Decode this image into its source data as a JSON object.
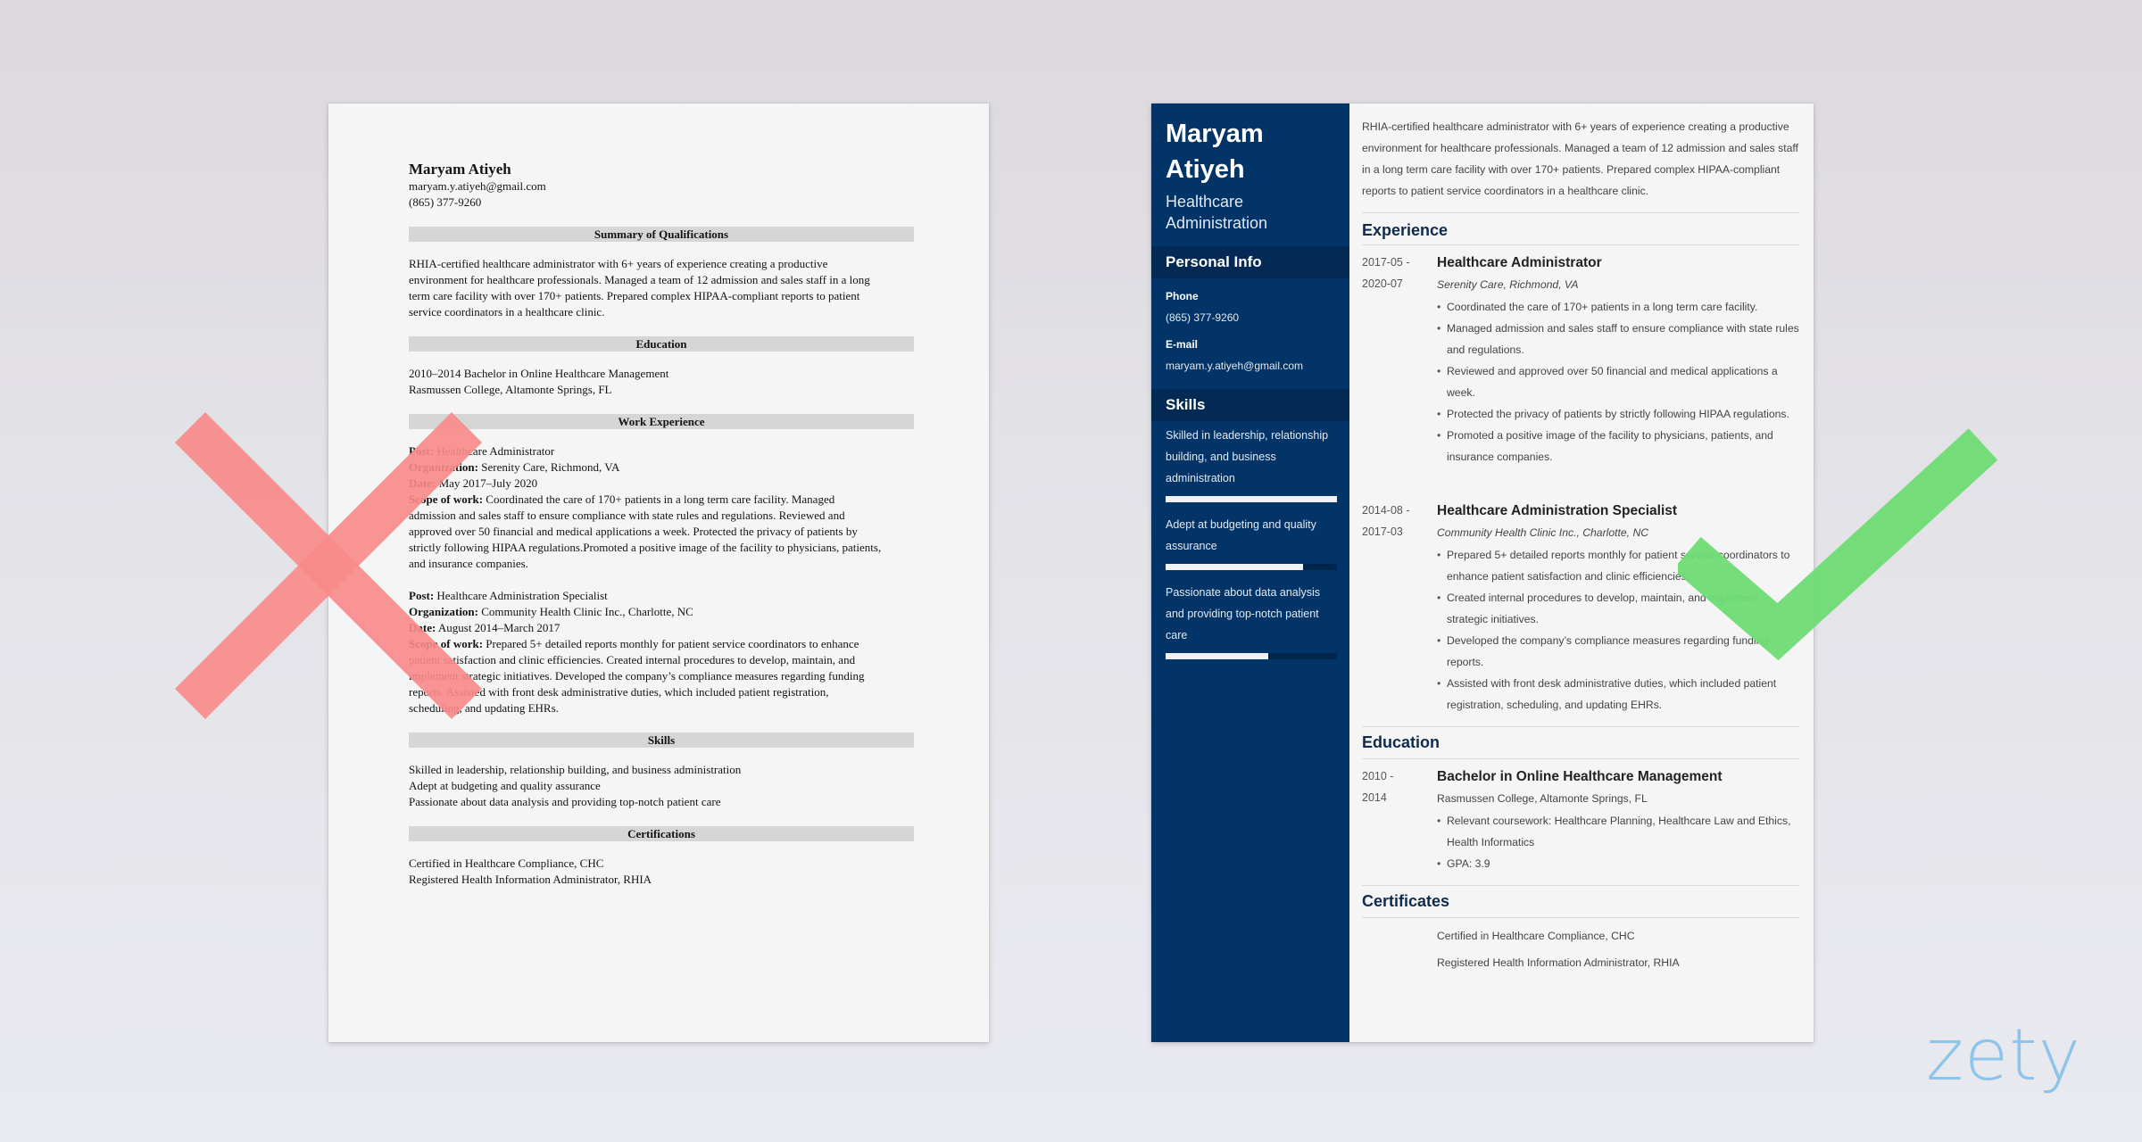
{
  "bad_resume": {
    "name": "Maryam Atiyeh",
    "email": "maryam.y.atiyeh@gmail.com",
    "phone": "(865) 377-9260",
    "sections": {
      "summary": "Summary of Qualifications",
      "education": "Education",
      "work": "Work Experience",
      "skills": "Skills",
      "certifications": "Certifications"
    },
    "summary_lines": [
      "RHIA-certified healthcare administrator with 6+ years of experience creating a productive",
      "environment for healthcare professionals. Managed a team of 12 admission and sales staff in a long",
      "term care facility with over 170+ patients. Prepared complex HIPAA-compliant reports to patient",
      "service coordinators in a healthcare clinic."
    ],
    "education_lines": [
      "2010–2014 Bachelor in Online Healthcare Management",
      "Rasmussen College, Altamonte Springs, FL"
    ],
    "labels": {
      "post": "Post:",
      "organization": "Organization:",
      "date": "Date:",
      "scope": "Scope of work:"
    },
    "jobs": [
      {
        "post": "Healthcare Administrator",
        "organization": "Serenity Care, Richmond, VA",
        "date": "May 2017–July 2020",
        "scope_lines": [
          "Coordinated the care of 170+ patients in a long term care facility. Managed",
          "admission and sales staff to ensure compliance with state rules and regulations.  Reviewed and",
          "approved over 50 financial and medical applications a week. Protected the privacy of patients by",
          "strictly following HIPAA regulations.Promoted a positive image of the facility to physicians, patients,",
          "and insurance companies."
        ]
      },
      {
        "post": "Healthcare Administration Specialist",
        "organization": "Community Health Clinic Inc., Charlotte, NC",
        "date": "August 2014–March 2017",
        "scope_lines": [
          "Prepared 5+ detailed reports monthly for patient service coordinators to enhance",
          "patient satisfaction and clinic efficiencies. Created internal procedures to develop, maintain, and",
          "implement strategic initiatives. Developed the company’s compliance measures regarding funding",
          "reports. Assisted with front desk administrative duties, which included patient registration,",
          "scheduling, and updating EHRs."
        ]
      }
    ],
    "skills": [
      "Skilled in leadership, relationship building, and business administration",
      "Adept at budgeting and quality assurance",
      "Passionate about data analysis and providing top-notch patient care"
    ],
    "certifications": [
      "Certified in Healthcare Compliance, CHC",
      "Registered Health Information Administrator, RHIA"
    ]
  },
  "good_resume": {
    "colors": {
      "sidebar": "#023467",
      "sidebar_header": "#022a55",
      "heading": "#0f2c4f"
    },
    "sidebar": {
      "first_name": "Maryam",
      "last_name": "Atiyeh",
      "title_line1": "Healthcare",
      "title_line2": "Administration",
      "personal_info_heading": "Personal Info",
      "phone_label": "Phone",
      "phone": "(865) 377-9260",
      "email_label": "E-mail",
      "email": "maryam.y.atiyeh@gmail.com",
      "skills_heading": "Skills",
      "skills": [
        {
          "text": "Skilled in leadership, relationship building, and business administration",
          "level": 1.0
        },
        {
          "text": "Adept at budgeting and quality assurance",
          "level": 0.8
        },
        {
          "text": "Passionate about data analysis and providing top-notch patient care",
          "level": 0.6
        }
      ]
    },
    "summary": "RHIA-certified healthcare administrator with 6+ years of experience creating a productive environment for healthcare professionals. Managed a team of 12 admission and sales staff in a long term care facility with over 170+ patients. Prepared complex HIPAA-compliant reports to patient service coordinators in a healthcare clinic.",
    "experience_heading": "Experience",
    "experience": [
      {
        "date_start": "2017-05 -",
        "date_end": "2020-07",
        "title": "Healthcare Administrator",
        "company": "Serenity Care, Richmond, VA",
        "bullets": [
          "Coordinated the care of 170+ patients in a long term care facility.",
          "Managed admission and sales staff to ensure compliance with state rules and regulations.",
          "Reviewed and approved over 50 financial and medical applications a week.",
          "Protected the privacy of patients by strictly following HIPAA regulations.",
          "Promoted a positive image of the facility to physicians, patients, and insurance companies."
        ]
      },
      {
        "date_start": "2014-08 -",
        "date_end": "2017-03",
        "title": "Healthcare Administration Specialist",
        "company": "Community Health Clinic Inc., Charlotte, NC",
        "bullets": [
          "Prepared 5+ detailed reports monthly for patient service coordinators to enhance patient satisfaction and clinic efficiencies.",
          "Created internal procedures to develop, maintain, and implement strategic initiatives.",
          "Developed the company’s compliance measures regarding funding reports.",
          "Assisted with front desk administrative duties, which included patient registration, scheduling, and updating EHRs."
        ]
      }
    ],
    "education_heading": "Education",
    "education": {
      "date_start": "2010 -",
      "date_end": "2014",
      "degree": "Bachelor in Online Healthcare Management",
      "school": "Rasmussen College, Altamonte Springs, FL",
      "bullets": [
        "Relevant coursework: Healthcare Planning, Healthcare Law and Ethics, Health Informatics",
        "GPA: 3.9"
      ]
    },
    "certificates_heading": "Certificates",
    "certificates": [
      "Certified in Healthcare Compliance, CHC",
      "Registered Health Information Administrator, RHIA"
    ]
  },
  "overlays": {
    "bad_mark": "x-icon",
    "good_mark": "checkmark-icon",
    "bad_color": "#f88a8a",
    "good_color": "#6edc74"
  },
  "brand": {
    "logo_text": "zety",
    "logo_color": "#8cc4ea"
  }
}
